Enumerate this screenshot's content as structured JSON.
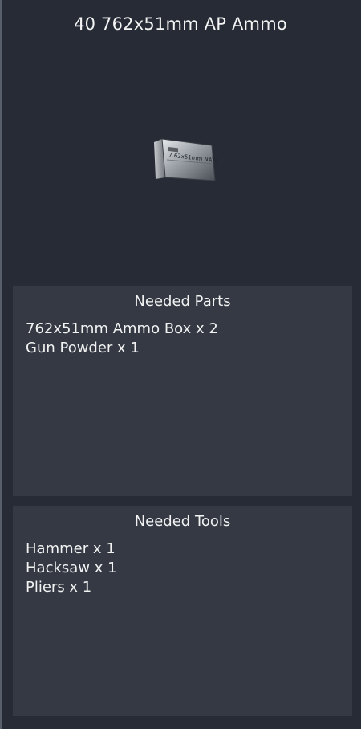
{
  "item": {
    "title": "40 762x51mm AP Ammo",
    "image_text": "7.62x51mm NATO"
  },
  "parts": {
    "heading": "Needed Parts",
    "items": [
      "762x51mm Ammo Box x 2",
      "Gun Powder x 1"
    ]
  },
  "tools": {
    "heading": "Needed Tools",
    "items": [
      "Hammer x 1",
      "Hacksaw x 1",
      "Pliers x 1"
    ]
  },
  "colors": {
    "background": "#262b35",
    "section_background": "#343944",
    "text": "#f2f2f2"
  }
}
